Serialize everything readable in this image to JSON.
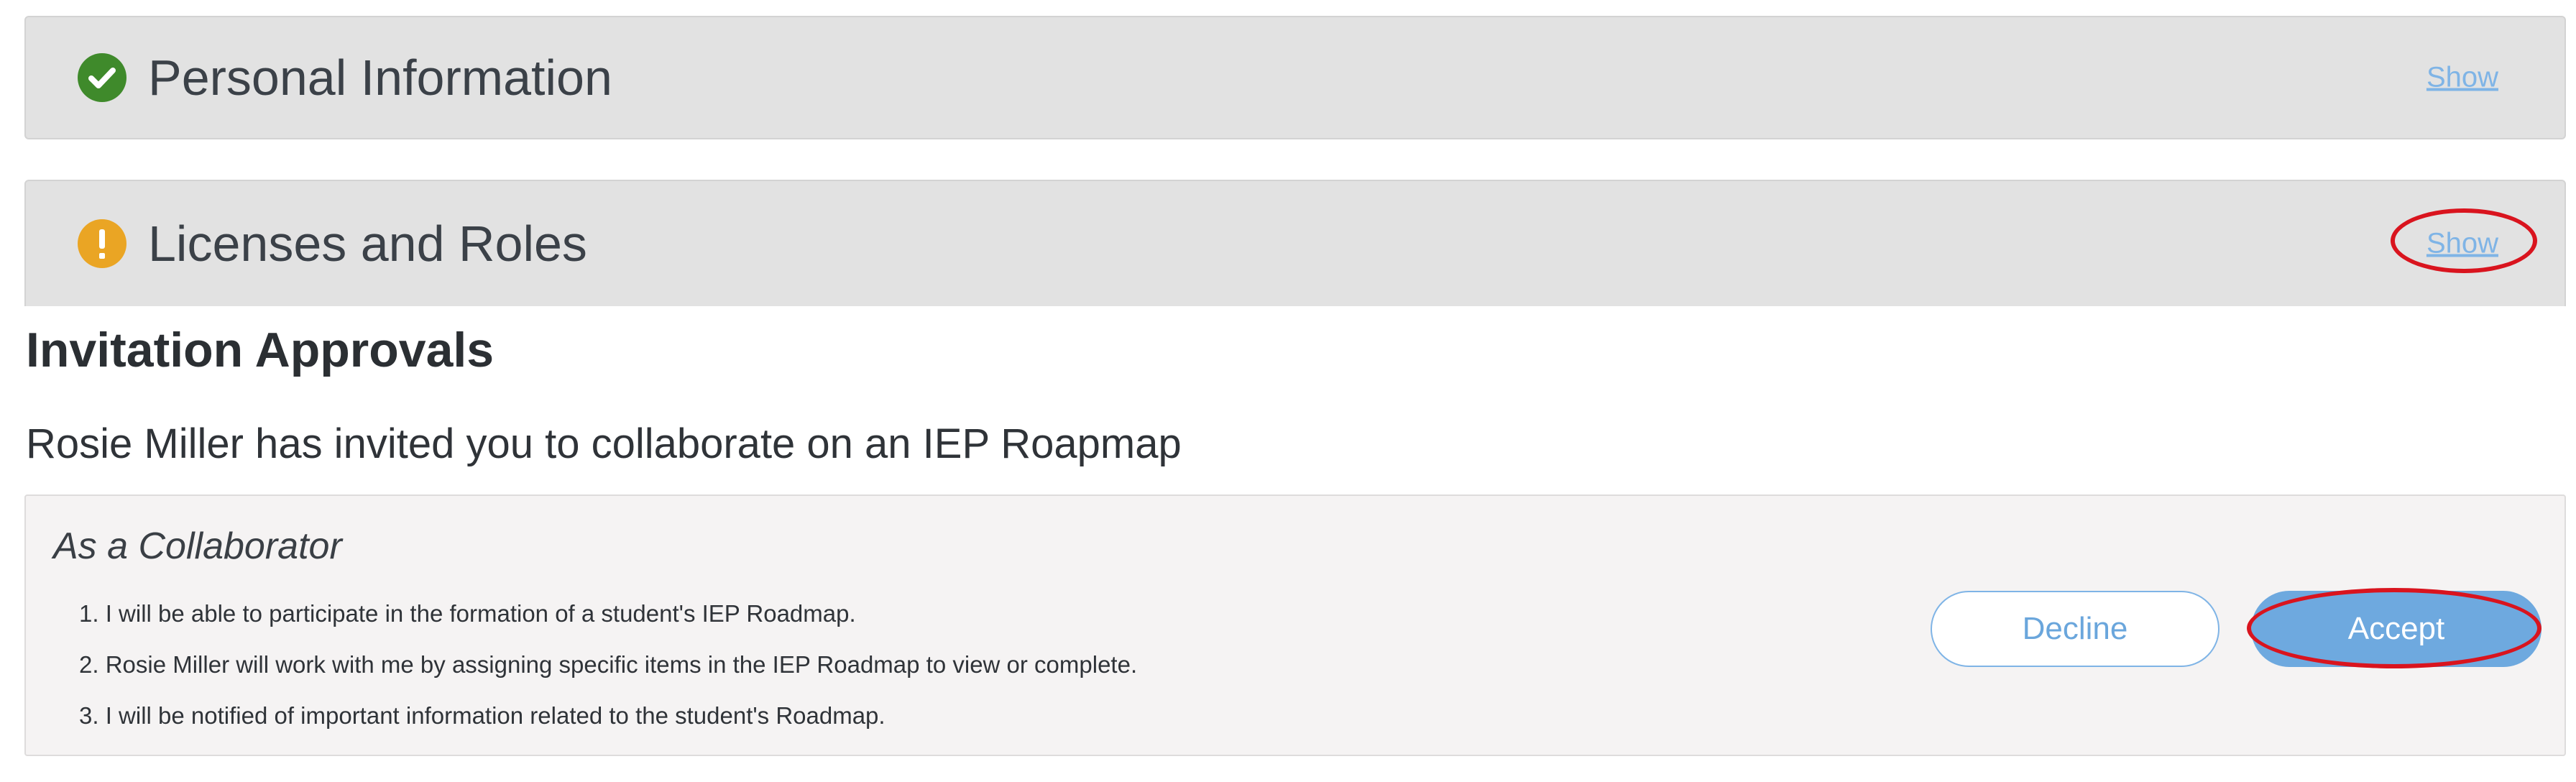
{
  "sections": {
    "personal": {
      "title": "Personal Information",
      "status_icon": "check-circle-icon",
      "show_label": "Show"
    },
    "licenses": {
      "title": "Licenses and Roles",
      "status_icon": "exclamation-circle-icon",
      "show_label": "Show"
    }
  },
  "invitation": {
    "heading": "Invitation Approvals",
    "message": "Rosie Miller has invited you to collaborate on an IEP Roapmap",
    "collaborator": {
      "title": "As a Collaborator",
      "items": [
        "1. I will be able to participate in the formation of a student's IEP Roadmap.",
        "2. Rosie Miller will work with me by assigning specific items in the IEP Roadmap to view or complete.",
        "3. I will be notified of important information related to the student's Roadmap."
      ]
    },
    "actions": {
      "decline_label": "Decline",
      "accept_label": "Accept"
    }
  },
  "colors": {
    "header_bg": "#e2e2e2",
    "ok_icon": "#3f8a2b",
    "warn_icon": "#eaa524",
    "link": "#7fb4e6",
    "accept_bg": "#6ea9df",
    "highlight": "#d9141e"
  }
}
